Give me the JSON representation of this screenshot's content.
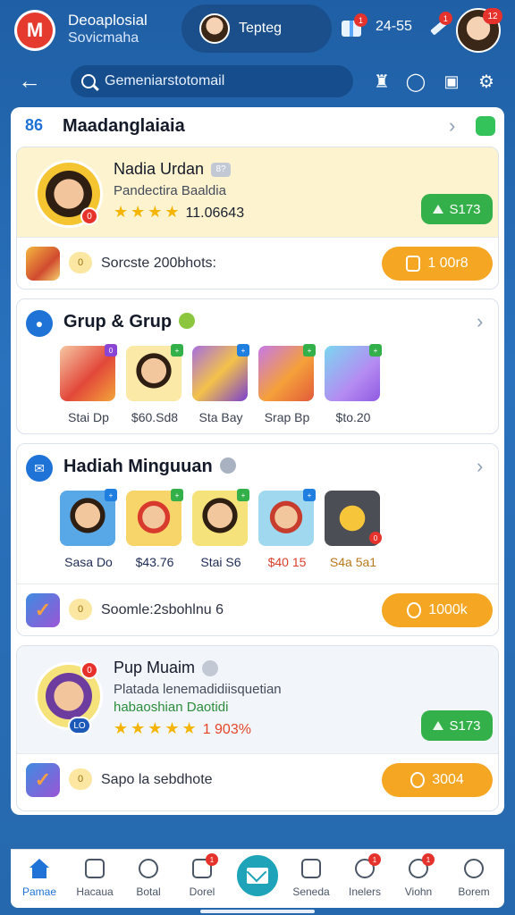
{
  "header": {
    "logo_letter": "M",
    "app_title_line1": "Deoaplosial",
    "app_title_line2": "Sovicmaha",
    "user_name": "Tepteg",
    "stat_value": "24-55",
    "stat_badge": "1",
    "pencil_badge": "1",
    "profile_badge": "12"
  },
  "search": {
    "placeholder": "Gemeniarstotomail"
  },
  "panel": {
    "icon_text": "86",
    "title": "Maadanglaiaia"
  },
  "featured": {
    "name": "Nadia Urdan",
    "tag": "8?",
    "subtitle": "Pandectira Baaldia",
    "avatar_badge": "0",
    "stars": "★★★★",
    "rating": "11.06643",
    "button_label": "S173",
    "action_text": "Sorcste 200bhots:",
    "action_chat": "0",
    "action_button": "1 00r8"
  },
  "group": {
    "title": "Grup & Grup",
    "items": [
      {
        "label": "Stai Dp",
        "badge": "0"
      },
      {
        "label": "$60.Sd8",
        "badge": "+"
      },
      {
        "label": "Sta Bay",
        "badge": "+"
      },
      {
        "label": "Srap Bp",
        "badge": "+"
      },
      {
        "label": "$to.20",
        "badge": "+"
      }
    ]
  },
  "weekly": {
    "title": "Hadiah Minguuan",
    "items": [
      {
        "label": "Sasa Do",
        "badge": "+"
      },
      {
        "label": "$43.76",
        "badge": "+"
      },
      {
        "label": "Stai S6",
        "badge": "+"
      },
      {
        "label": "$40 15",
        "badge": "+"
      },
      {
        "label": "S4a 5a1",
        "badge": "0"
      }
    ],
    "action_text": "Soomle:2sbohlnu 6",
    "action_chat": "0",
    "action_button": "1000k"
  },
  "second_profile": {
    "name": "Pup Muaim",
    "subtitle": "Platada lenemadidiisquetian",
    "subtitle2": "habaoshian Daotidi",
    "avatar_badge": "0",
    "avatar_badge2": "LO",
    "stars": "★★★★★",
    "rating": "1 903%",
    "button_label": "S173",
    "action_text": "Sapo la sebdhote",
    "action_chat": "0",
    "action_button": "3004"
  },
  "nav": {
    "items": [
      {
        "label": "Pamae"
      },
      {
        "label": "Hacaua"
      },
      {
        "label": "Botal"
      },
      {
        "label": "Dorel",
        "badge": "1"
      },
      {
        "label": "Seneda"
      },
      {
        "label": "Inelers",
        "badge": "1"
      },
      {
        "label": "Viohn",
        "badge": "1"
      },
      {
        "label": "Borem"
      }
    ]
  },
  "colors": {
    "background": "#2a72bd",
    "accent_orange": "#f5a623",
    "accent_green": "#34b04a",
    "badge_red": "#e5322c",
    "featured_bg": "#fdf4cf"
  }
}
